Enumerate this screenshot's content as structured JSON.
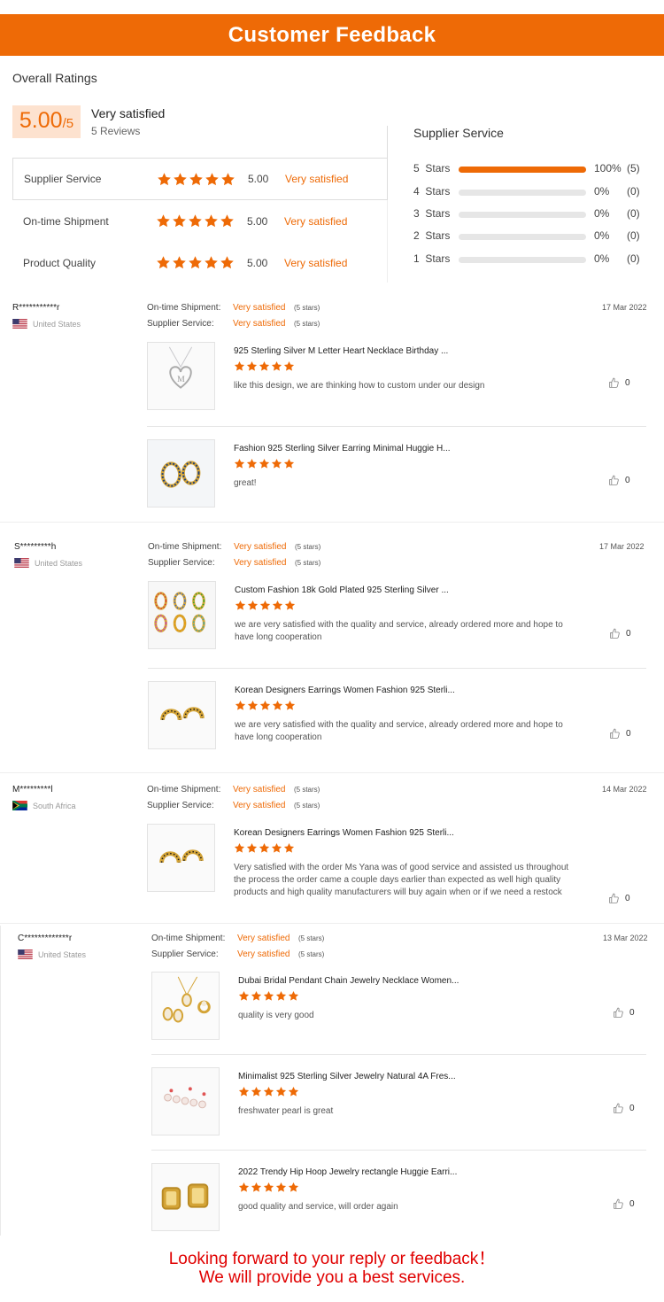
{
  "header": {
    "title": "Customer Feedback"
  },
  "overall": {
    "title": "Overall Ratings",
    "score": "5.00",
    "score_max": "/5",
    "label": "Very satisfied",
    "reviews": "5 Reviews",
    "criteria": [
      {
        "label": "Supplier Service",
        "score": "5.00",
        "text": "Very satisfied",
        "stars": 5
      },
      {
        "label": "On-time Shipment",
        "score": "5.00",
        "text": "Very satisfied",
        "stars": 5
      },
      {
        "label": "Product Quality",
        "score": "5.00",
        "text": "Very satisfied",
        "stars": 5
      }
    ]
  },
  "supplier_service": {
    "title": "Supplier Service",
    "rows": [
      {
        "stars": "5",
        "label": "Stars",
        "pct": "100%",
        "count": "(5)",
        "fill": 1.0
      },
      {
        "stars": "4",
        "label": "Stars",
        "pct": "0%",
        "count": "(0)",
        "fill": 0
      },
      {
        "stars": "3",
        "label": "Stars",
        "pct": "0%",
        "count": "(0)",
        "fill": 0
      },
      {
        "stars": "2",
        "label": "Stars",
        "pct": "0%",
        "count": "(0)",
        "fill": 0
      },
      {
        "stars": "1",
        "label": "Stars",
        "pct": "0%",
        "count": "(0)",
        "fill": 0
      }
    ]
  },
  "reviews": [
    {
      "name": "R***********r",
      "country": "United States",
      "flag": "us",
      "date": "17 Mar 2022",
      "shipment_label": "On-time Shipment:",
      "shipment_value": "Very satisfied",
      "shipment_stars": "(5 stars)",
      "service_label": "Supplier Service:",
      "service_value": "Very satisfied",
      "service_stars": "(5 stars)",
      "items": [
        {
          "title": "925 Sterling Silver M Letter Heart Necklace Birthday ...",
          "comment": "like this design, we are thinking how to custom under our design",
          "likes": "0",
          "stars": 5,
          "thumb": "necklace-heart"
        },
        {
          "title": "Fashion 925 Sterling Silver Earring Minimal Huggie H...",
          "comment": "great!",
          "likes": "0",
          "stars": 5,
          "thumb": "huggie-blue"
        }
      ]
    },
    {
      "name": "S*********h",
      "country": "United States",
      "flag": "us",
      "date": "17 Mar 2022",
      "shipment_label": "On-time Shipment:",
      "shipment_value": "Very satisfied",
      "shipment_stars": "(5 stars)",
      "service_label": "Supplier Service:",
      "service_value": "Very satisfied",
      "service_stars": "(5 stars)",
      "items": [
        {
          "title": "Custom Fashion 18k Gold Plated 925 Sterling Silver ...",
          "comment": "we are very satisfied with the quality and service, already ordered more and hope to have long cooperation",
          "likes": "0",
          "stars": 5,
          "thumb": "multi-hoops"
        },
        {
          "title": "Korean Designers Earrings Women Fashion 925 Sterli...",
          "comment": "we are very satisfied with the quality and service, already ordered more and hope to have long cooperation",
          "likes": "0",
          "stars": 5,
          "thumb": "gold-huggie"
        }
      ]
    },
    {
      "name": "M*********l",
      "country": "South Africa",
      "flag": "za",
      "date": "14 Mar 2022",
      "shipment_label": "On-time Shipment:",
      "shipment_value": "Very satisfied",
      "shipment_stars": "(5 stars)",
      "service_label": "Supplier Service:",
      "service_value": "Very satisfied",
      "service_stars": "(5 stars)",
      "items": [
        {
          "title": "Korean Designers Earrings Women Fashion 925 Sterli...",
          "comment": "Very satisfied with the order Ms Yana was of good service and assisted us throughout the process the order came a couple days earlier than expected as well high quality products and high quality manufacturers will buy again when or if we need a restock",
          "likes": "0",
          "stars": 5,
          "thumb": "gold-huggie"
        }
      ]
    },
    {
      "name": "C*************r",
      "country": "United States",
      "flag": "us",
      "date": "13 Mar 2022",
      "shipment_label": "On-time Shipment:",
      "shipment_value": "Very satisfied",
      "shipment_stars": "(5 stars)",
      "service_label": "Supplier Service:",
      "service_value": "Very satisfied",
      "service_stars": "(5 stars)",
      "items": [
        {
          "title": "Dubai Bridal Pendant Chain Jewelry Necklace Women...",
          "comment": "quality is very good",
          "likes": "0",
          "stars": 5,
          "thumb": "bridal-set"
        },
        {
          "title": "Minimalist 925 Sterling Silver Jewelry Natural 4A Fres...",
          "comment": "freshwater pearl is great",
          "likes": "0",
          "stars": 5,
          "thumb": "pearl-studs"
        },
        {
          "title": "2022 Trendy Hip Hoop Jewelry rectangle Huggie Earri...",
          "comment": "good quality and service, will order again",
          "likes": "0",
          "stars": 5,
          "thumb": "rect-huggie"
        }
      ]
    }
  ],
  "footer": {
    "line1": "Looking forward to your reply or feedback！",
    "line2": "We will provide you a best services."
  },
  "colors": {
    "accent": "#ee6a06",
    "footer_text": "#e00000"
  }
}
